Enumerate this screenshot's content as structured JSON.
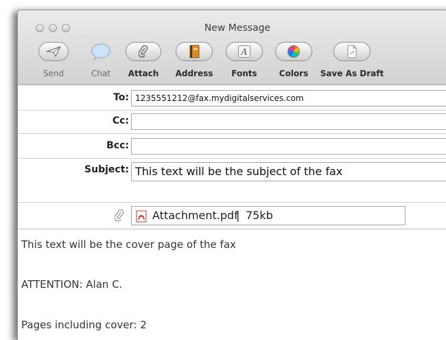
{
  "window": {
    "title": "New Message"
  },
  "toolbar": {
    "items": [
      {
        "label": "Send",
        "icon": "send-icon"
      },
      {
        "label": "Chat",
        "icon": "chat-icon"
      },
      {
        "label": "Attach",
        "icon": "paperclip-icon"
      },
      {
        "label": "Address",
        "icon": "address-book-icon"
      },
      {
        "label": "Fonts",
        "icon": "fonts-icon"
      },
      {
        "label": "Colors",
        "icon": "color-wheel-icon"
      },
      {
        "label": "Save As Draft",
        "icon": "draft-icon"
      }
    ]
  },
  "header": {
    "to": {
      "label": "To:",
      "value": "1235551212@fax.mydigitalservices.com"
    },
    "cc": {
      "label": "Cc:",
      "value": ""
    },
    "bcc": {
      "label": "Bcc:",
      "value": ""
    },
    "subject": {
      "label": "Subject:",
      "value": "This text will be the subject of the fax"
    },
    "attachment": {
      "icon": "pdf-icon",
      "name": "Attachment.pdf",
      "separator": "|",
      "size": "75kb"
    }
  },
  "body": {
    "lines": [
      "This text will be the cover page of the fax",
      "ATTENTION: Alan C.",
      "Pages including cover: 2"
    ]
  }
}
